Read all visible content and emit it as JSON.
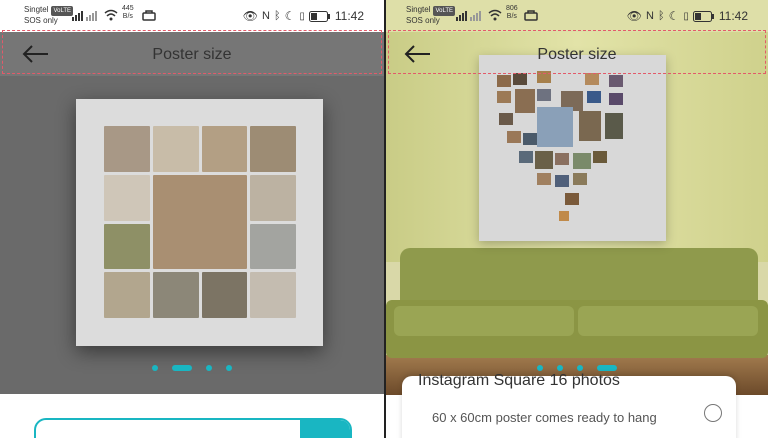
{
  "left": {
    "status": {
      "carrier": "Singtel",
      "carrier_tag": "VoLTE",
      "sos": "SOS only",
      "speed_value": "445",
      "speed_unit": "B/s",
      "time": "11:42"
    },
    "header": {
      "title": "Poster size"
    },
    "carousel": {
      "count": 4,
      "active_index": 1
    }
  },
  "right": {
    "status": {
      "carrier": "Singtel",
      "carrier_tag": "VoLTE",
      "sos": "SOS only",
      "speed_value": "806",
      "speed_unit": "B/s",
      "time": "11:42"
    },
    "header": {
      "title": "Poster size"
    },
    "carousel": {
      "count": 4,
      "active_index": 3
    },
    "option": {
      "title": "Instagram Square 16 photos",
      "description": "60 x 60cm poster comes ready to hang"
    }
  },
  "colors": {
    "accent": "#19b6c2",
    "dashed_highlight": "#e35a6a"
  }
}
